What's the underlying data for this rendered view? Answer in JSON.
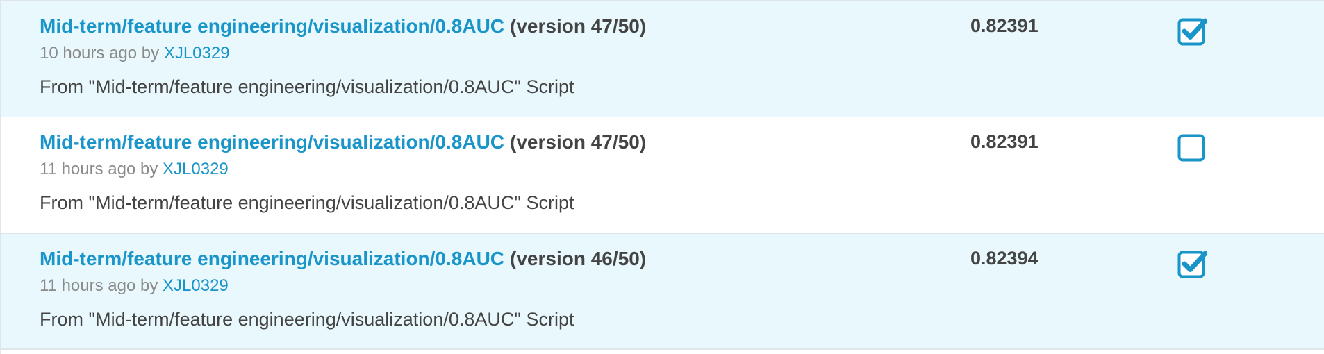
{
  "submissions": [
    {
      "title": "Mid-term/feature engineering/visualization/0.8AUC",
      "version": "(version 47/50)",
      "time": "10 hours ago",
      "by_label": "by",
      "author": "XJL0329",
      "description": "From \"Mid-term/feature engineering/visualization/0.8AUC\" Script",
      "score": "0.82391",
      "selected": true
    },
    {
      "title": "Mid-term/feature engineering/visualization/0.8AUC",
      "version": "(version 47/50)",
      "time": "11 hours ago",
      "by_label": "by",
      "author": "XJL0329",
      "description": "From \"Mid-term/feature engineering/visualization/0.8AUC\" Script",
      "score": "0.82391",
      "selected": false
    },
    {
      "title": "Mid-term/feature engineering/visualization/0.8AUC",
      "version": "(version 46/50)",
      "time": "11 hours ago",
      "by_label": "by",
      "author": "XJL0329",
      "description": "From \"Mid-term/feature engineering/visualization/0.8AUC\" Script",
      "score": "0.82394",
      "selected": true
    }
  ],
  "colors": {
    "link": "#1a95c9",
    "selected_row_bg": "#e8f8fd",
    "text_dark": "#444444",
    "text_muted": "#8a8a8a"
  },
  "icons": {
    "checked": "checkbox-checked-icon",
    "unchecked": "checkbox-unchecked-icon"
  }
}
